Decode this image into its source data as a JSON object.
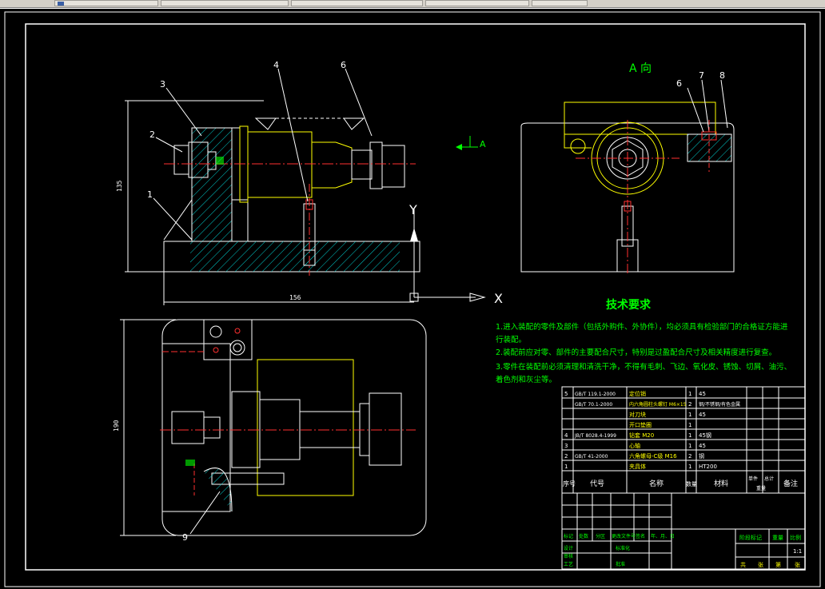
{
  "taskbar": {
    "buttons": [
      {
        "label": ""
      },
      {
        "label": ""
      },
      {
        "label": ""
      },
      {
        "label": ""
      },
      {
        "label": ""
      }
    ]
  },
  "drawing": {
    "view_a_title": "A 向",
    "view_arrow_label": "A",
    "axis_x": "X",
    "axis_y": "Y",
    "leaders_front": [
      "1",
      "2",
      "3",
      "4",
      "6"
    ],
    "leaders_side": [
      "6",
      "7",
      "8"
    ],
    "leader_bottom": "9",
    "dim_height": "135",
    "dim_width": "156",
    "dim_plan_height": "190",
    "tech_title": "技术要求",
    "tech_lines": [
      "1.进入装配的零件及部件（包括外购件、外协件），均必须具有检验部门的合格证方能进",
      "行装配。",
      "2.装配前应对零、部件的主要配合尺寸，特别是过盈配合尺寸及相关精度进行复查。",
      "3.零件在装配前必须清理和清洗干净，不得有毛刺、飞边、氧化皮、锈蚀、切屑、油污、",
      "着色剂和灰尘等。"
    ]
  },
  "bom": {
    "rows": [
      {
        "no": "5",
        "code": "GB/T 119.1-2000",
        "name": "定位销",
        "qty": "1",
        "mat": "45"
      },
      {
        "no": "",
        "code": "GB/T 70.1-2000",
        "name": "内六角圆柱头螺钉 M6×15",
        "qty": "2",
        "mat": "钢/不锈钢/有色金属"
      },
      {
        "no": "",
        "code": "",
        "name": "对刀块",
        "qty": "1",
        "mat": "45"
      },
      {
        "no": "",
        "code": "",
        "name": "开口垫圈",
        "qty": "1",
        "mat": ""
      },
      {
        "no": "4",
        "code": "JB/T 8028.4-1999",
        "name": "钻套 M20",
        "qty": "1",
        "mat": "45钢"
      },
      {
        "no": "3",
        "code": "",
        "name": "心轴",
        "qty": "1",
        "mat": "45"
      },
      {
        "no": "2",
        "code": "GB/T 41-2000",
        "name": "六角螺母-C级 M16",
        "qty": "2",
        "mat": "钢"
      },
      {
        "no": "1",
        "code": "",
        "name": "夹具体",
        "qty": "1",
        "mat": "HT200"
      }
    ],
    "header": {
      "no": "序号",
      "code": "代号",
      "name": "名称",
      "qty": "数量",
      "mat": "材料",
      "single": "单件",
      "total": "总计",
      "weight": "重量",
      "note": "备注"
    },
    "title_block": {
      "labels_row": [
        "标记",
        "处数",
        "分区",
        "更改文件号",
        "签名",
        "年、月、日"
      ],
      "design": "设计",
      "std": "标准化",
      "audit": "审核",
      "craft": "工艺",
      "approve": "批准",
      "stage": "阶段标记",
      "weight": "重量",
      "scale": "比例",
      "scale_value": "1:1",
      "sheets": [
        "共",
        "张",
        "第",
        "张"
      ]
    }
  }
}
